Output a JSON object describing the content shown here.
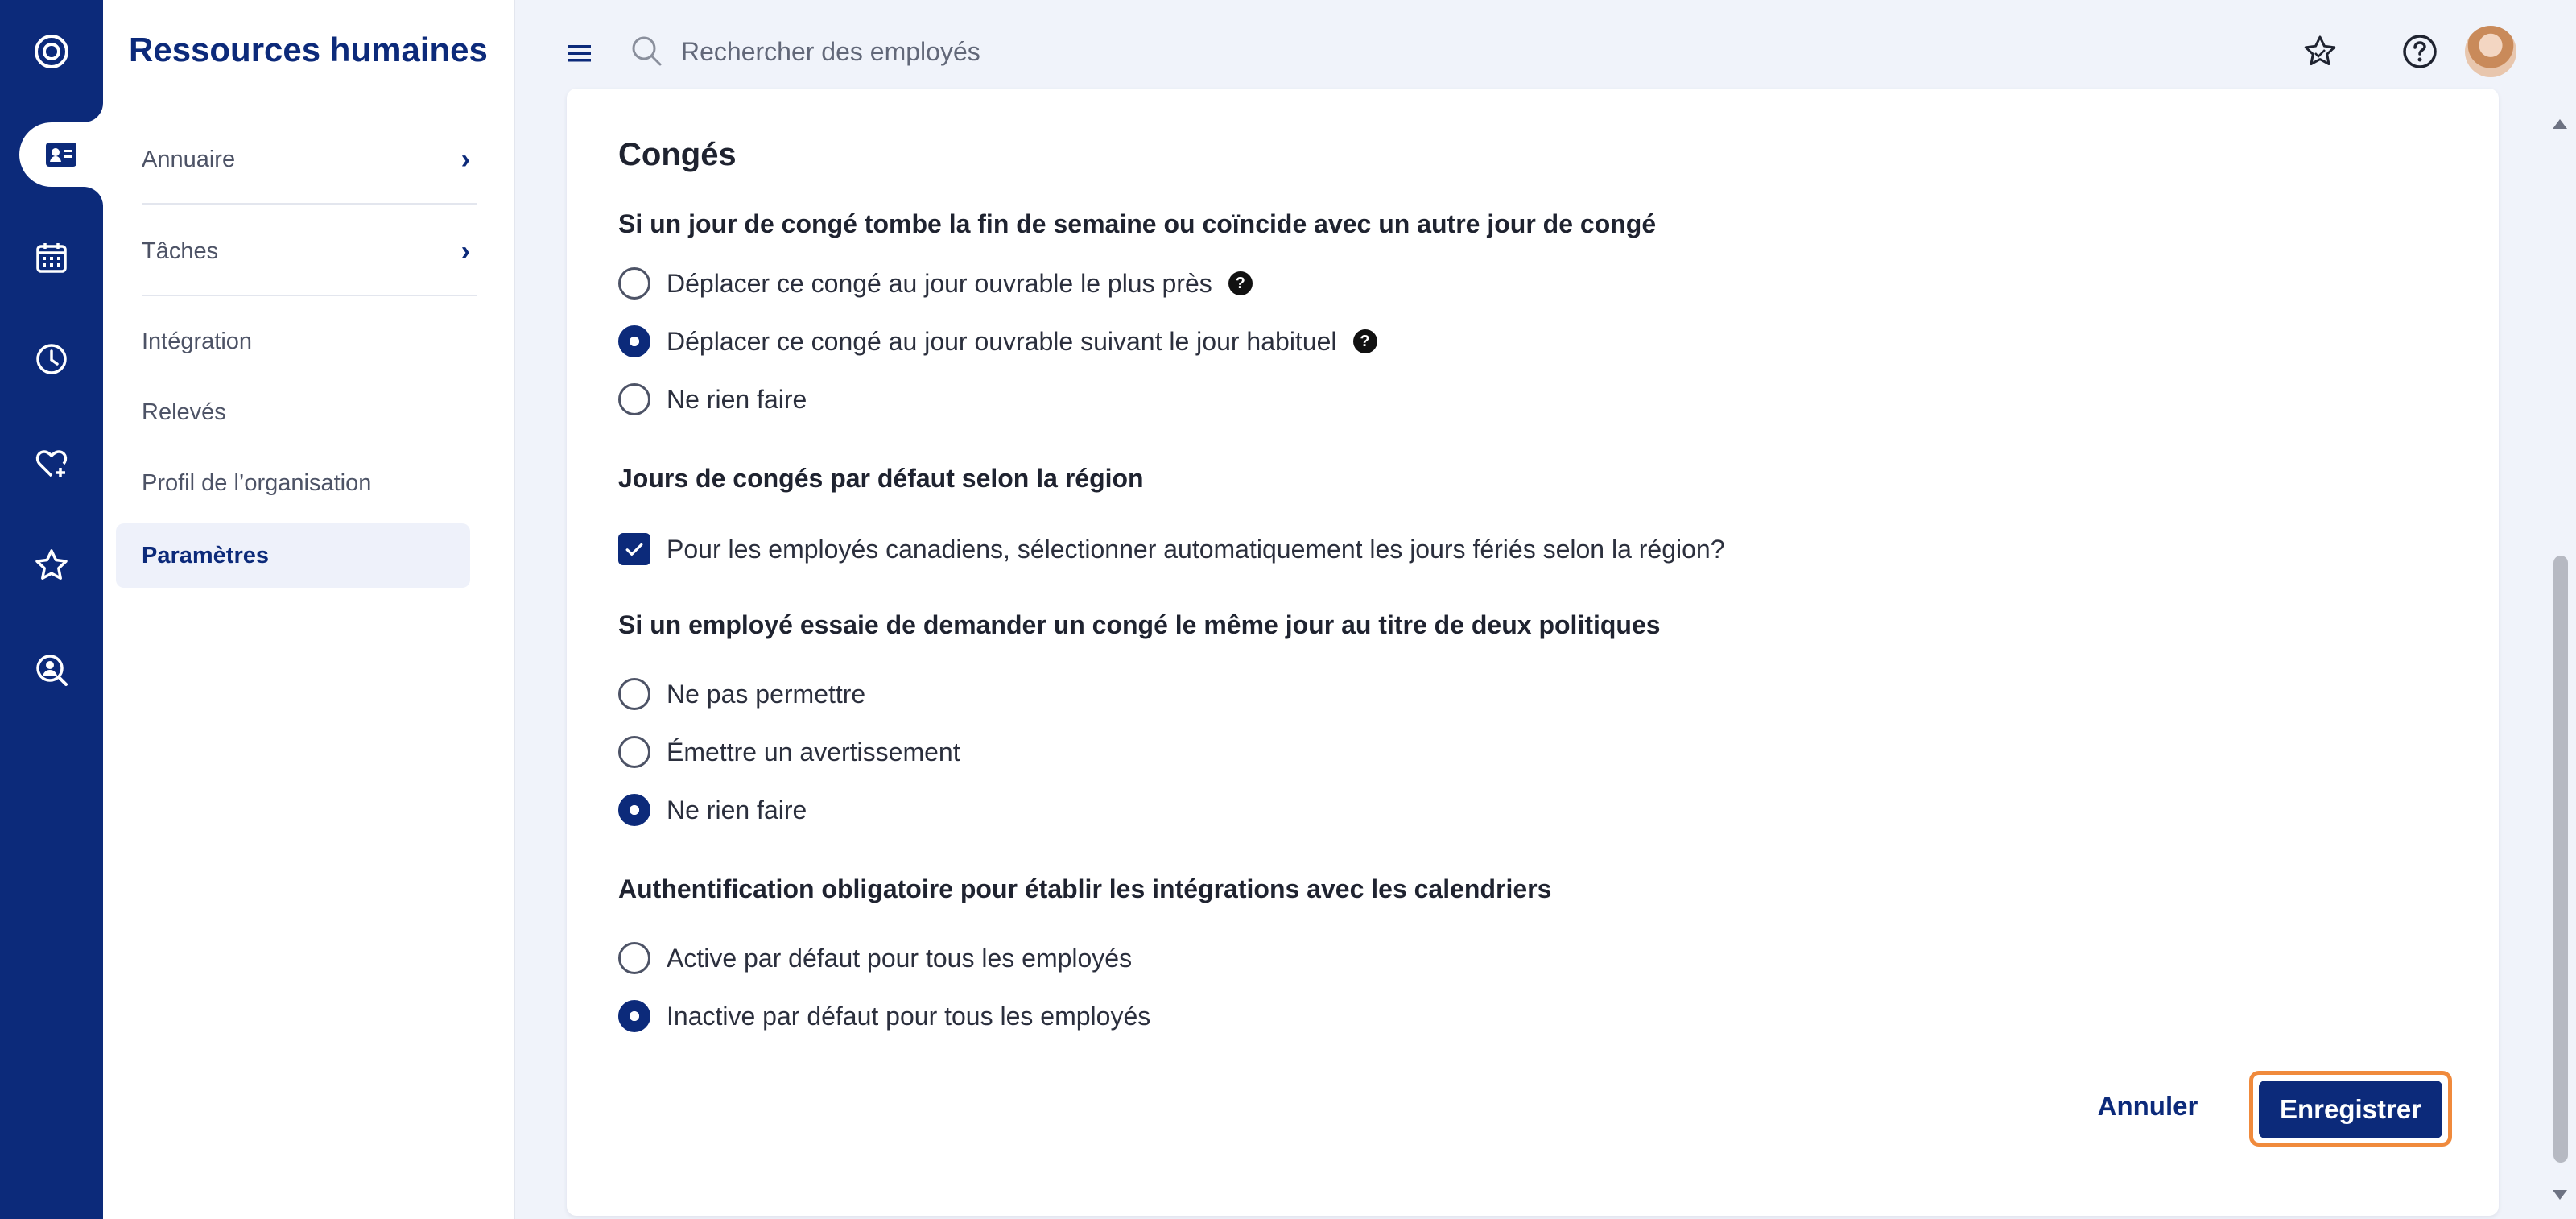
{
  "app": {
    "title": "Ressources humaines"
  },
  "rail": {
    "items": [
      {
        "icon": "logo-icon"
      },
      {
        "icon": "employee-card-icon",
        "active": true
      },
      {
        "icon": "calendar-icon"
      },
      {
        "icon": "clock-icon"
      },
      {
        "icon": "heart-plus-icon"
      },
      {
        "icon": "star-icon"
      },
      {
        "icon": "search-person-icon"
      }
    ]
  },
  "sidebar": {
    "items": [
      {
        "label": "Annuaire",
        "has_submenu": true
      },
      {
        "label": "Tâches",
        "has_submenu": true
      },
      {
        "label": "Intégration"
      },
      {
        "label": "Relevés"
      },
      {
        "label": "Profil de l’organisation"
      },
      {
        "label": "Paramètres",
        "active": true
      }
    ]
  },
  "topbar": {
    "search_placeholder": "Rechercher des employés",
    "icons": [
      "menu-icon",
      "search-icon",
      "star-badge-icon",
      "help-icon",
      "avatar"
    ]
  },
  "settings": {
    "section_title": "Congés",
    "q1": {
      "label": "Si un jour de congé tombe la fin de semaine ou coïncide avec un autre jour de congé",
      "options": [
        "Déplacer ce congé au jour ouvrable le plus près",
        "Déplacer ce congé au jour ouvrable suivant le jour habituel",
        "Ne rien faire"
      ],
      "selected": 1
    },
    "q2": {
      "label": "Jours de congés par défaut selon la région",
      "checkbox_label": "Pour les employés canadiens, sélectionner automatiquement les jours fériés selon la région?",
      "checked": true
    },
    "q3": {
      "label": "Si un employé essaie de demander un congé le même jour au titre de deux politiques",
      "options": [
        "Ne pas permettre",
        "Émettre un avertissement",
        "Ne rien faire"
      ],
      "selected": 2
    },
    "q4": {
      "label": "Authentification obligatoire pour établir les intégrations avec les calendriers",
      "options": [
        "Active par défaut pour tous les employés",
        "Inactive par défaut pour tous les employés"
      ],
      "selected": 1
    },
    "help_glyph": "?"
  },
  "actions": {
    "cancel_label": "Annuler",
    "save_label": "Enregistrer"
  },
  "colors": {
    "brand": "#0c2a7a",
    "focus_ring": "#f08a3c",
    "background": "#f0f3fa"
  }
}
